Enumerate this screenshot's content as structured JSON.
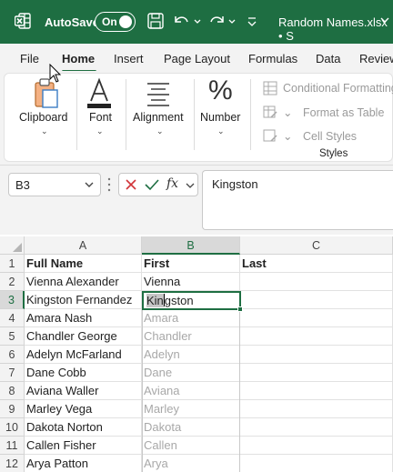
{
  "titlebar": {
    "autosave_label": "AutoSave",
    "autosave_state": "On",
    "filename": "Random Names.xlsx",
    "filename_sep": "•",
    "filename_suffix": "S",
    "icons": [
      "excel-logo-icon",
      "save-icon",
      "undo-icon",
      "redo-icon",
      "customize-toolbar-icon",
      "chevron-down-icon"
    ],
    "accent": "#1e6e42"
  },
  "ribbon_tabs": [
    "File",
    "Home",
    "Insert",
    "Page Layout",
    "Formulas",
    "Data",
    "Review"
  ],
  "active_tab": "Home",
  "ribbon": {
    "clipboard": "Clipboard",
    "font": "Font",
    "alignment": "Alignment",
    "number": "Number",
    "number_glyph": "%",
    "styles": {
      "conditional_formatting": "Conditional Formatting",
      "format_as_table": "Format as Table",
      "cell_styles": "Cell Styles",
      "group_label": "Styles"
    }
  },
  "formula_bar": {
    "name_box": "B3",
    "formula": "Kingston",
    "fx_label": "fx"
  },
  "columns": [
    "A",
    "B",
    "C"
  ],
  "selected_column": "B",
  "selected_row": "3",
  "rows": [
    {
      "num": "1",
      "a": "Full Name",
      "b": "First",
      "c": "Last"
    },
    {
      "num": "2",
      "a": "Vienna Alexander",
      "b": "Vienna",
      "c": ""
    },
    {
      "num": "3",
      "a": "Kingston Fernandez",
      "b": "Kingston",
      "c": ""
    },
    {
      "num": "4",
      "a": "Amara Nash",
      "b": "Amara",
      "c": ""
    },
    {
      "num": "5",
      "a": "Chandler George",
      "b": "Chandler",
      "c": ""
    },
    {
      "num": "6",
      "a": "Adelyn McFarland",
      "b": "Adelyn",
      "c": ""
    },
    {
      "num": "7",
      "a": "Dane Cobb",
      "b": "Dane",
      "c": ""
    },
    {
      "num": "8",
      "a": "Aviana Waller",
      "b": "Aviana",
      "c": ""
    },
    {
      "num": "9",
      "a": "Marley Vega",
      "b": "Marley",
      "c": ""
    },
    {
      "num": "10",
      "a": "Dakota Norton",
      "b": "Dakota",
      "c": ""
    },
    {
      "num": "11",
      "a": "Callen Fisher",
      "b": "Callen",
      "c": ""
    },
    {
      "num": "12",
      "a": "Arya Patton",
      "b": "Arya",
      "c": ""
    }
  ],
  "active_cell": {
    "typed": "Kin",
    "remainder": "gston"
  }
}
